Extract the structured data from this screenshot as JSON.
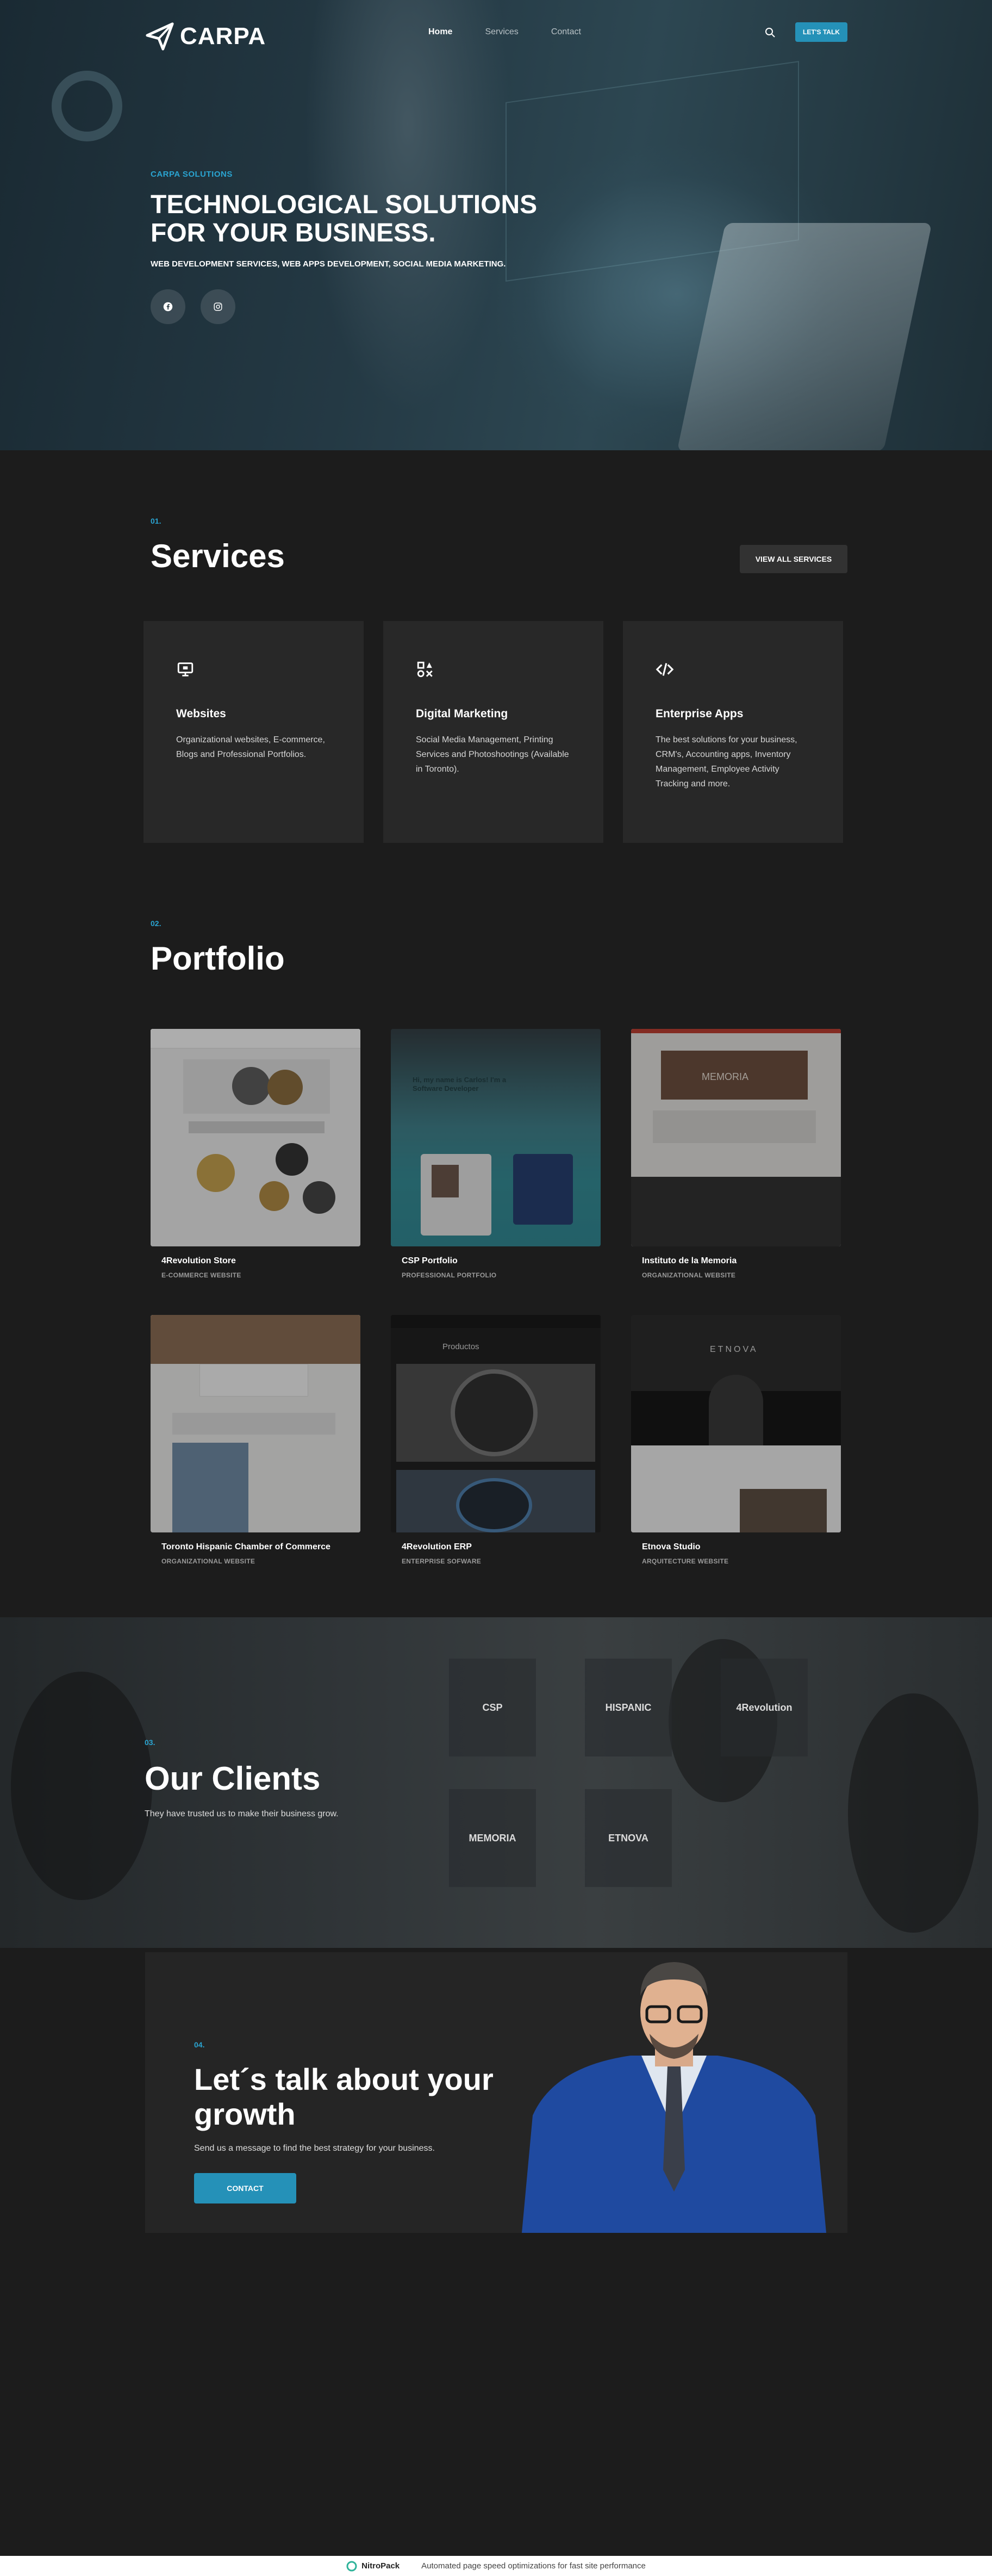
{
  "nav": {
    "logo_text": "CARPA",
    "items": [
      {
        "label": "Home"
      },
      {
        "label": "Services"
      },
      {
        "label": "Contact"
      }
    ],
    "cta": "LET'S TALK"
  },
  "hero": {
    "eyebrow": "CARPA SOLUTIONS",
    "title": "TECHNOLOGICAL SOLUTIONS FOR YOUR BUSINESS.",
    "subtitle": "WEB DEVELOPMENT SERVICES, WEB APPS DEVELOPMENT, SOCIAL MEDIA MARKETING."
  },
  "services": {
    "number": "01.",
    "title": "Services",
    "view_all": "VIEW ALL SERVICES",
    "cards": [
      {
        "icon": "monitor-icon",
        "title": "Websites",
        "text": "Organizational websites, E-commerce, Blogs and Professional Portfolios."
      },
      {
        "icon": "megaphone-icon",
        "title": "Digital Marketing",
        "text": "Social Media Management, Printing Services and Photoshootings (Available in Toronto)."
      },
      {
        "icon": "code-icon",
        "title": "Enterprise Apps",
        "text": "The best solutions for your business, CRM's, Accounting apps, Inventory Management, Employee Activity Tracking and more."
      }
    ]
  },
  "portfolio": {
    "number": "02.",
    "title": "Portfolio",
    "items": [
      {
        "name": "4Revolution Store",
        "category": "E-COMMERCE WEBSITE"
      },
      {
        "name": "CSP Portfolio",
        "category": "PROFESSIONAL PORTFOLIO"
      },
      {
        "name": "Instituto de la Memoria",
        "category": "ORGANIZATIONAL WEBSITE"
      },
      {
        "name": "Toronto Hispanic Chamber of Commerce",
        "category": "ORGANIZATIONAL WEBSITE"
      },
      {
        "name": "4Revolution ERP",
        "category": "ENTERPRISE SOFWARE"
      },
      {
        "name": "Etnova Studio",
        "category": "ARQUITECTURE WEBSITE"
      }
    ],
    "thumb_texts": {
      "csp_greeting": "Hi, my name is Carlos! I'm a Software Developer",
      "erp_app_title": "Productos",
      "etnova_logo": "ETNOVA",
      "memoria_logo": "MEMORIA"
    }
  },
  "clients": {
    "number": "03.",
    "title": "Our Clients",
    "subtitle": "They have trusted us to make their business grow.",
    "logos": [
      "CSP",
      "HISPANIC",
      "4Revolution",
      "MEMORIA",
      "ETNOVA"
    ]
  },
  "contact": {
    "number": "04.",
    "title": "Let´s talk about your growth",
    "subtitle": "Send us a message to find the best strategy for your business.",
    "button": "CONTACT"
  },
  "footer_bar": {
    "brand": "NitroPack",
    "text": "Automated page speed optimizations for fast site performance"
  },
  "colors": {
    "accent": "#2591b8",
    "background": "#1c1c1c",
    "card": "#282828"
  }
}
